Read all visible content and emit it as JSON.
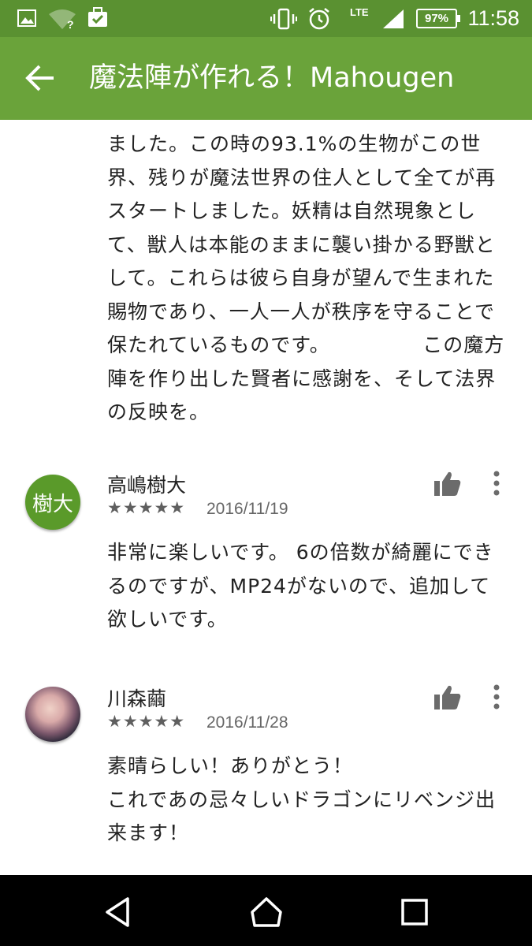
{
  "status_bar": {
    "time": "11:58",
    "battery": "97%",
    "network": "LTE",
    "icons": [
      "image-icon",
      "wifi-question-icon",
      "briefcase-check-icon",
      "vibrate-icon",
      "alarm-icon",
      "signal-icon",
      "battery-icon"
    ]
  },
  "app_bar": {
    "title": "魔法陣が作れる！Mahougen",
    "back_icon": "arrow-left-icon"
  },
  "first_review_text": "ました。この時の93.1%の生物がこの世界、残りが魔法世界の住人として全てが再スタートしました。妖精は自然現象として、獣人は本能のままに襲い掛かる野獣として。これらは彼ら自身が望んで生まれた賜物であり、一人一人が秩序を守ることで保たれているものです。　　　　　この魔方陣を作り出した賢者に感謝を、そして法界の反映を。",
  "reviews": [
    {
      "avatar_text": "樹大",
      "name": "高嶋樹大",
      "stars": "★★★★★",
      "rating": 5,
      "date": "2016/11/19",
      "text": "非常に楽しいです。 6の倍数が綺麗にできるのですが、MP24がないので、追加して欲しいです。"
    },
    {
      "avatar_text": "",
      "name": "川森繭",
      "stars": "★★★★★",
      "rating": 5,
      "date": "2016/11/28",
      "text": "素晴らしい！ありがとう！\nこれであの忌々しいドラゴンにリベンジ出来ます！"
    }
  ],
  "nav_bar": {
    "icons": [
      "back-triangle-icon",
      "home-icon",
      "recents-icon"
    ]
  },
  "colors": {
    "status_bar": "#5a9131",
    "app_bar": "#6aa33a",
    "avatar_green": "#5a9a2a"
  }
}
